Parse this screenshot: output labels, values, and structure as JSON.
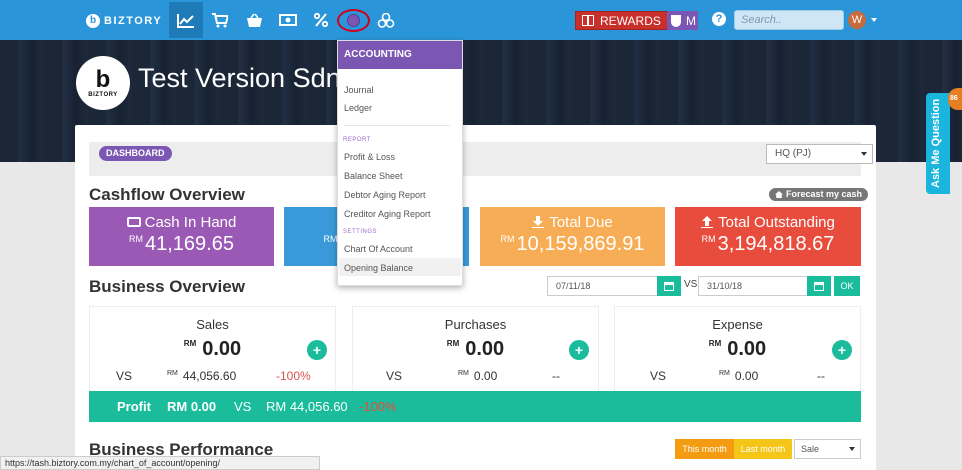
{
  "nav": {
    "brand": "BIZTORY",
    "rewards_label": "REWARDS",
    "m_label": "M",
    "help_label": "?",
    "search_placeholder": "Search..",
    "user_initial": "W"
  },
  "hero": {
    "logo_text": "BIZTORY",
    "company": "Test Version Sdn"
  },
  "accounting_menu": {
    "header": "ACCOUNTING",
    "items": [
      "Journal",
      "Ledger"
    ],
    "report_label": "REPORT",
    "report_items": [
      "Profit & Loss",
      "Balance Sheet",
      "Debtor Aging Report",
      "Creditor Aging Report"
    ],
    "settings_label": "SETTINGS",
    "settings_items": [
      "Chart Of Account",
      "Opening Balance"
    ]
  },
  "dashboard": {
    "crumb": "DASHBOARD",
    "branch": "HQ (PJ)",
    "cashflow_title": "Cashflow Overview",
    "forecast_label": "Forecast my cash",
    "currency": "RM",
    "cards": [
      {
        "title": "Cash In Hand",
        "amount": "41,169.65",
        "color": "#9b59b6"
      },
      {
        "title": "",
        "amount": "",
        "color": "#3a9ad9"
      },
      {
        "title": "Total Due",
        "amount": "10,159,869.91",
        "color": "#f6ad55"
      },
      {
        "title": "Total Outstanding",
        "amount": "3,194,818.67",
        "color": "#e74c3c"
      }
    ],
    "business_title": "Business Overview",
    "date_from": "07/11/18",
    "vs": "VS",
    "date_to": "31/10/18",
    "ok": "OK",
    "boxes": [
      {
        "title": "Sales",
        "amount": "0.00",
        "vs": "VS",
        "prev": "44,056.60",
        "pct": "-100%",
        "pct_color": "#d9534f"
      },
      {
        "title": "Purchases",
        "amount": "0.00",
        "vs": "VS",
        "prev": "0.00",
        "pct": "--",
        "pct_color": "#333333"
      },
      {
        "title": "Expense",
        "amount": "0.00",
        "vs": "VS",
        "prev": "0.00",
        "pct": "--",
        "pct_color": "#333333"
      }
    ],
    "profit": {
      "label": "Profit",
      "amount": "RM 0.00",
      "vs": "VS",
      "prev": "RM 44,056.60",
      "pct": "-100%"
    },
    "performance_title": "Business Performance",
    "this_month": "This month",
    "last_month": "Last month",
    "perf_select": "Sale"
  },
  "side_tab": {
    "label": "Ask Me Question",
    "badge": "86"
  },
  "status_url": "https://tash.biztory.com.my/chart_of_account/opening/"
}
